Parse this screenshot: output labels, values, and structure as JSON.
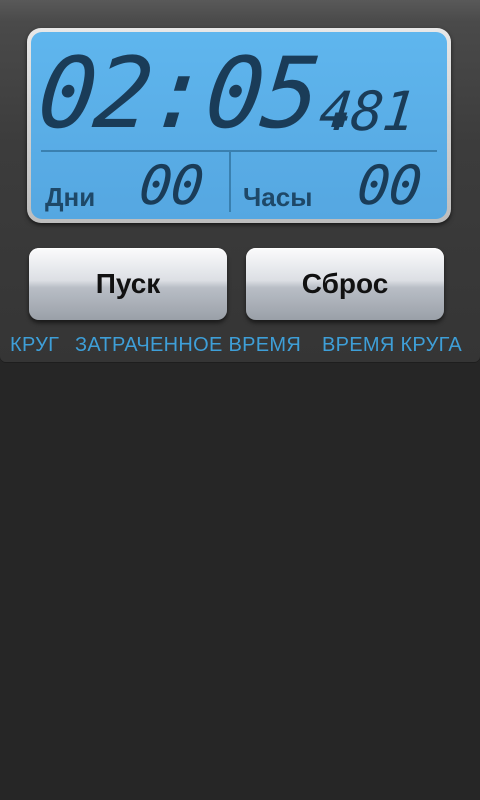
{
  "display": {
    "main_time": "02:05.",
    "fraction": "481",
    "days_label": "Дни",
    "days_value": "00",
    "hours_label": "Часы",
    "hours_value": "00"
  },
  "buttons": {
    "start_label": "Пуск",
    "reset_label": "Сброс"
  },
  "tabs": [
    {
      "label": "КРУГ"
    },
    {
      "label": "ЗАТРАЧЕННОЕ ВРЕМЯ"
    },
    {
      "label": "ВРЕМЯ КРУГА"
    }
  ],
  "colors": {
    "lcd_background": "#5aaee7",
    "segment_digit": "#1a3c58",
    "tab_text": "#3e9fd8",
    "app_background": "#262626"
  }
}
